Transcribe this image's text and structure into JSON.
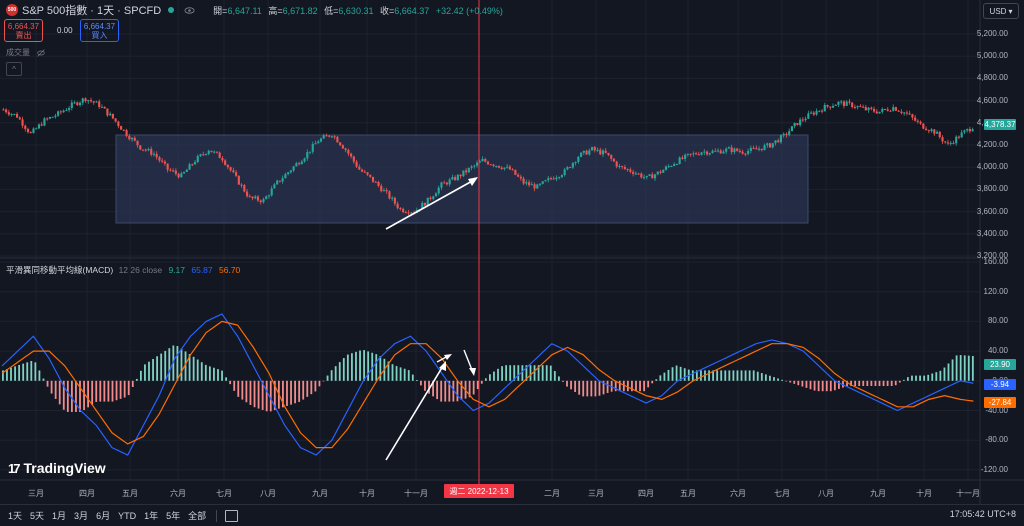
{
  "symbol": {
    "logo_text": "500",
    "title": "S&P 500指數 · 1天 · SPCFD",
    "ohlc": [
      {
        "k": "開=",
        "v": "6,647.11"
      },
      {
        "k": "高=",
        "v": "6,671.82"
      },
      {
        "k": "低=",
        "v": "6,630.31"
      },
      {
        "k": "收=",
        "v": "6,664.37"
      },
      {
        "k": "",
        "v": "+32.42 (+0.49%)"
      }
    ]
  },
  "trade": {
    "sell_price": "6,664.37",
    "sell_label": "賣出",
    "spread": "0.00",
    "buy_price": "6,664.37",
    "buy_label": "買入"
  },
  "volume_label": "成交量",
  "collapse_icon": "chevron-up-icon",
  "currency": "USD",
  "macd": {
    "name": "平滑異同移動平均線(MACD)",
    "params": "12 26 close",
    "v1": "9.17",
    "v2": "65.87",
    "v3": "56.70"
  },
  "price_axis": [
    "5,200.00",
    "5,000.00",
    "4,800.00",
    "4,600.00",
    "4,400.00",
    "4,200.00",
    "4,000.00",
    "3,800.00",
    "3,600.00",
    "3,400.00",
    "3,200.00"
  ],
  "price_tag": "4,378.37",
  "macd_axis": [
    "160.00",
    "120.00",
    "80.00",
    "40.00",
    "0.00",
    "-40.00",
    "-80.00",
    "-120.00"
  ],
  "macd_tags": {
    "hist": "23.90",
    "macd": "-3.94",
    "signal": "-27.84"
  },
  "time_axis": [
    "三月",
    "四月",
    "五月",
    "六月",
    "七月",
    "八月",
    "九月",
    "十月",
    "十一月",
    "二月",
    "三月",
    "四月",
    "五月",
    "六月",
    "七月",
    "八月",
    "九月",
    "十月",
    "十一月"
  ],
  "crosshair_date": "週二  2022-12-13",
  "brand": "TradingView",
  "ranges": [
    "1天",
    "5天",
    "1月",
    "3月",
    "6月",
    "YTD",
    "1年",
    "5年",
    "全部"
  ],
  "time_readout": "17:05:42 UTC+8",
  "colors": {
    "up": "#26a69a",
    "down": "#ef5350",
    "macd": "#2962ff",
    "signal": "#ff6d00",
    "crosshair": "#f23645",
    "box": "#2a3450"
  },
  "chart_data": {
    "type": "candlestick-with-macd",
    "price_ylim": [
      3200,
      5200
    ],
    "macd_ylim": [
      -120,
      160
    ],
    "close": [
      4520,
      4460,
      4300,
      4420,
      4480,
      4560,
      4620,
      4560,
      4440,
      4300,
      4180,
      4120,
      3980,
      3920,
      4060,
      4160,
      4080,
      3900,
      3720,
      3700,
      3860,
      3980,
      4100,
      4240,
      4300,
      4160,
      3980,
      3880,
      3760,
      3620,
      3600,
      3700,
      3840,
      3900,
      3980,
      4060,
      4020,
      3980,
      3860,
      3820,
      3900,
      3960,
      4100,
      4160,
      4120,
      4000,
      3960,
      3900,
      3960,
      4040,
      4100,
      4140,
      4140,
      4160,
      4140,
      4160,
      4200,
      4280,
      4400,
      4480,
      4540,
      4580,
      4560,
      4520,
      4500,
      4540,
      4480,
      4380,
      4320,
      4200,
      4300,
      4380
    ],
    "macd": [
      20,
      40,
      60,
      30,
      -10,
      -40,
      -60,
      -90,
      -100,
      -60,
      -20,
      30,
      60,
      80,
      90,
      60,
      20,
      -20,
      -60,
      -90,
      -100,
      -80,
      -40,
      0,
      30,
      50,
      60,
      40,
      10,
      -20,
      -40,
      -30,
      -10,
      10,
      30,
      50,
      40,
      20,
      0,
      -10,
      -20,
      -30,
      -20,
      0,
      10,
      20,
      30,
      40,
      50,
      55,
      50,
      40,
      20,
      0,
      -10,
      -20,
      -30,
      -40,
      -30,
      -20,
      -10,
      0,
      -3.94
    ],
    "signal": [
      10,
      25,
      40,
      40,
      20,
      -10,
      -40,
      -70,
      -85,
      -75,
      -45,
      -5,
      35,
      65,
      80,
      75,
      45,
      10,
      -35,
      -70,
      -90,
      -90,
      -65,
      -30,
      5,
      35,
      50,
      50,
      30,
      0,
      -25,
      -35,
      -25,
      -5,
      15,
      35,
      45,
      35,
      15,
      0,
      -10,
      -20,
      -25,
      -15,
      0,
      10,
      20,
      30,
      40,
      50,
      50,
      45,
      30,
      10,
      -5,
      -15,
      -25,
      -35,
      -35,
      -25,
      -20,
      -25,
      -27.84
    ],
    "annotations": [
      "consolidation-box",
      "up-arrow-price",
      "up-arrow-macd",
      "crossover-arrows",
      "crosshair-2022-12-13"
    ]
  }
}
